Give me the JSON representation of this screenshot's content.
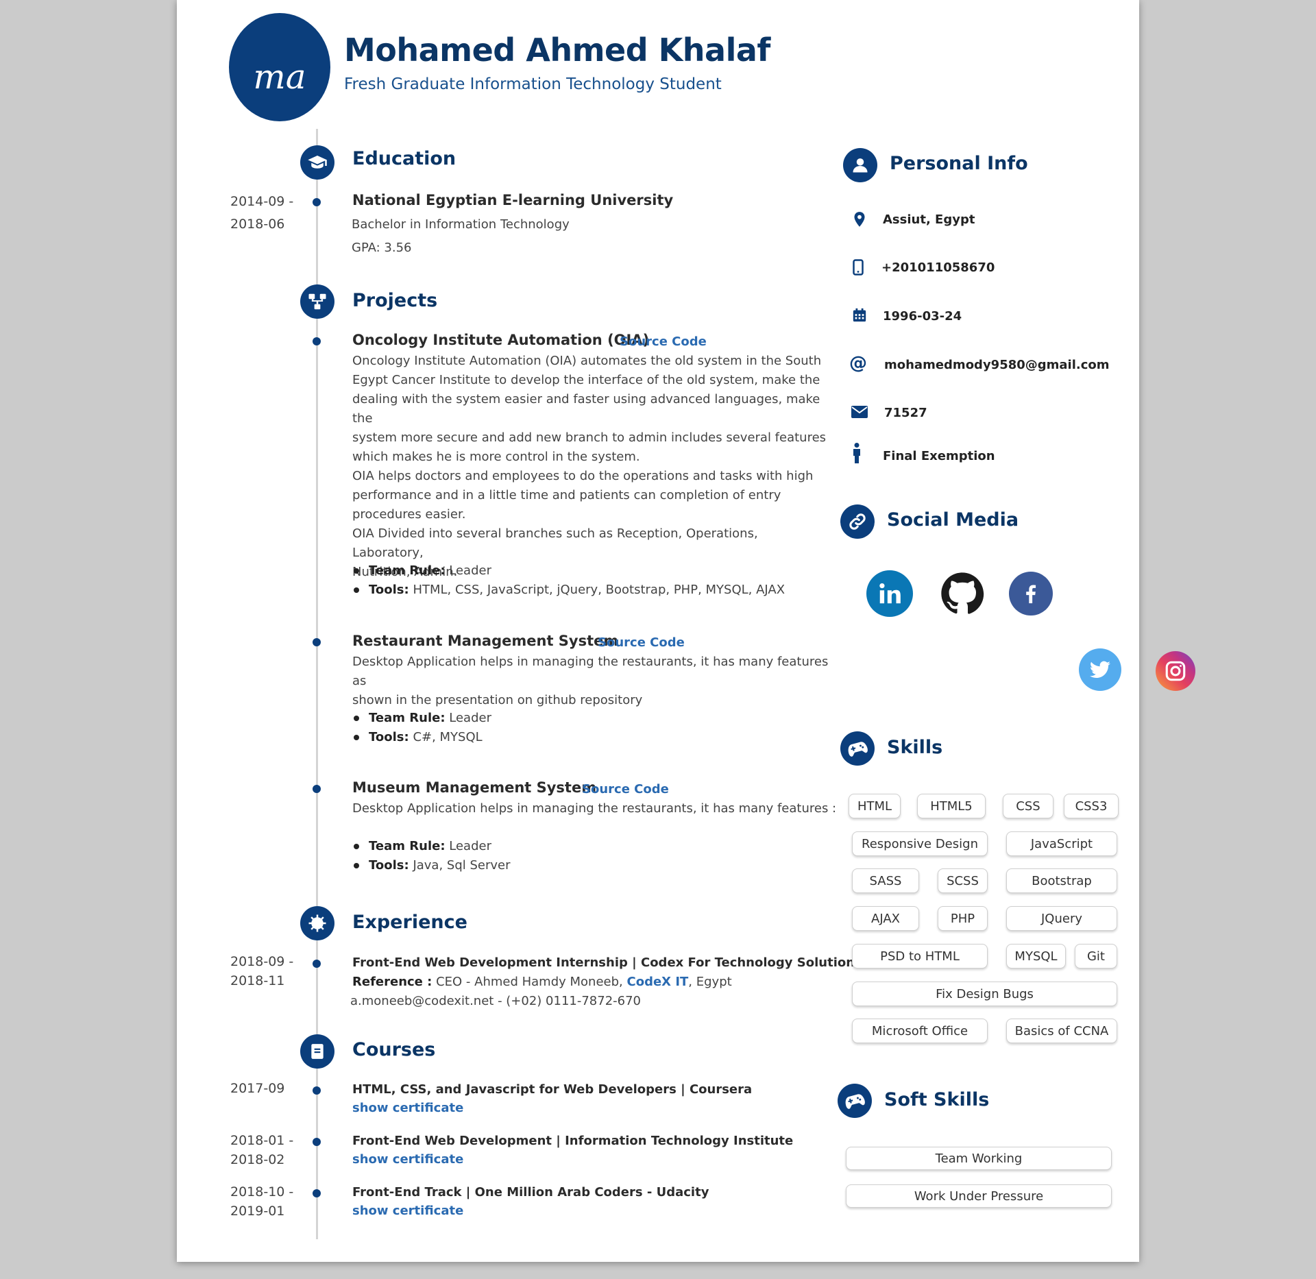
{
  "header": {
    "logo_text": "ma",
    "name": "Mohamed Ahmed Khalaf",
    "subtitle": "Fresh Graduate Information Technology Student"
  },
  "colors": {
    "accent": "#0b3e7c",
    "link": "#2a6ab1",
    "title": "#0b3565"
  },
  "education": {
    "title": "Education",
    "icon": "graduation-cap-icon",
    "items": [
      {
        "date_start": "2014-09 -",
        "date_end": "2018-06",
        "school": "National Egyptian E-learning University",
        "degree": "Bachelor in Information Technology",
        "gpa": "GPA: 3.56"
      }
    ]
  },
  "projects": {
    "title": "Projects",
    "icon": "sitemap-icon",
    "source_label": "Source Code",
    "team_label": "Team Rule:",
    "tools_label": "Tools:",
    "items": [
      {
        "name": "Oncology Institute Automation (OIA)",
        "desc": [
          "Oncology Institute Automation (OIA) automates the old system in the South",
          "Egypt Cancer Institute to develop the interface of the old system, make the",
          "dealing with the system easier and faster using advanced languages, make the",
          "system more secure and add new branch to admin includes several features",
          "which makes he is more control in the system.",
          "OIA helps doctors and employees to do the operations and tasks with high",
          "performance and in a little time and patients can completion of entry",
          "procedures easier.",
          "OIA Divided into several branches such as Reception, Operations, Laboratory,",
          "Nutrition, Admin."
        ],
        "team": "Leader",
        "tools": "HTML, CSS, JavaScript, jQuery, Bootstrap, PHP, MYSQL, AJAX"
      },
      {
        "name": "Restaurant Management System",
        "desc": [
          "Desktop Application helps in managing the restaurants, it has many features as",
          "shown in the presentation on github repository"
        ],
        "team": "Leader",
        "tools": "C#, MYSQL"
      },
      {
        "name": "Museum Management System",
        "desc": [
          "Desktop Application helps in managing the restaurants, it has many features :"
        ],
        "team": "Leader",
        "tools": "Java, Sql Server"
      }
    ]
  },
  "experience": {
    "title": "Experience",
    "icon": "gear-icon",
    "date_start": "2018-09 -",
    "date_end": "2018-11",
    "role": "Front-End Web Development Internship | Codex For Technology Solutions",
    "ref_label": "Reference :",
    "ref_text": "CEO - Ahmed Hamdy Moneeb,",
    "company_link": "CodeX IT",
    "location": ", Egypt",
    "contact": "a.moneeb@codexit.net - (+02) 0111-7872-670"
  },
  "courses": {
    "title": "Courses",
    "icon": "book-icon",
    "cert_label": "show certificate",
    "items": [
      {
        "date_start": "2017-09",
        "date_end": "",
        "name": "HTML, CSS, and Javascript for Web Developers | Coursera"
      },
      {
        "date_start": "2018-01 -",
        "date_end": "2018-02",
        "name": "Front-End Web Development | Information Technology Institute"
      },
      {
        "date_start": "2018-10 -",
        "date_end": "2019-01",
        "name": "Front-End Track | One Million Arab Coders - Udacity"
      }
    ]
  },
  "personal_info": {
    "title": "Personal Info",
    "icon": "user-icon",
    "items": [
      {
        "icon": "map-marker-icon",
        "text": "Assiut, Egypt"
      },
      {
        "icon": "mobile-phone-icon",
        "text": "+201011058670"
      },
      {
        "icon": "calendar-icon",
        "text": "1996-03-24"
      },
      {
        "icon": "at-icon",
        "text": "mohamedmody9580@gmail.com"
      },
      {
        "icon": "envelope-icon",
        "text": "71527"
      },
      {
        "icon": "person-icon",
        "text": "Final Exemption"
      }
    ]
  },
  "social": {
    "title": "Social Media",
    "icon": "link-icon",
    "items": [
      {
        "icon": "linkedin-icon",
        "color": "#0a77b5"
      },
      {
        "icon": "github-icon",
        "color": "#1b1b1b"
      },
      {
        "icon": "facebook-icon",
        "color": "#3b5998"
      },
      {
        "icon": "twitter-icon",
        "color": "#55acee"
      },
      {
        "icon": "instagram-icon",
        "color": "#dc2743"
      }
    ]
  },
  "skills": {
    "title": "Skills",
    "icon": "gamepad-icon",
    "items": [
      "HTML",
      "HTML5",
      "CSS",
      "CSS3",
      "Responsive Design",
      "JavaScript",
      "SASS",
      "SCSS",
      "Bootstrap",
      "AJAX",
      "PHP",
      "JQuery",
      "PSD to HTML",
      "MYSQL",
      "Git",
      "Fix Design Bugs",
      "Microsoft Office",
      "Basics of CCNA"
    ]
  },
  "soft_skills": {
    "title": "Soft Skills",
    "icon": "gamepad-icon",
    "items": [
      "Team Working",
      "Work Under Pressure"
    ]
  }
}
